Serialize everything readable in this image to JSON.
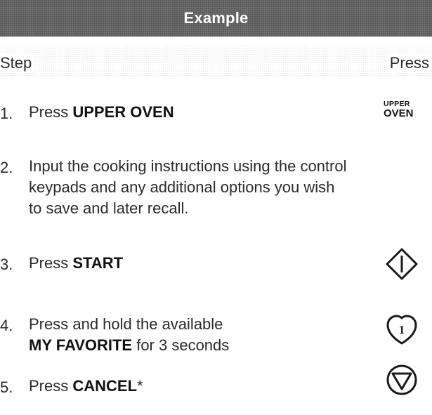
{
  "header": {
    "title": "Example"
  },
  "columns": {
    "step": "Step",
    "press": "Press"
  },
  "steps": [
    {
      "num": "1.",
      "prefix": "Press ",
      "bold": "UPPER OVEN",
      "suffix": "",
      "icon": "upper-oven-key",
      "icon_line1": "UPPER",
      "icon_line2": "OVEN"
    },
    {
      "num": "2.",
      "line1": "Input the cooking instructions using the control",
      "line2": "keypads and any additional options you wish",
      "line3": "to save and later recall."
    },
    {
      "num": "3.",
      "prefix": "Press ",
      "bold": "START",
      "icon": "start-diamond-icon"
    },
    {
      "num": "4.",
      "line1": "Press and hold the available",
      "bold": "MY FAVORITE",
      "suffix": " for 3 seconds",
      "icon": "favorite-1-icon",
      "icon_label": "1"
    },
    {
      "num": "5.",
      "prefix": "Press ",
      "bold": "CANCEL",
      "suffix": "*",
      "icon": "cancel-triangle-icon"
    }
  ]
}
